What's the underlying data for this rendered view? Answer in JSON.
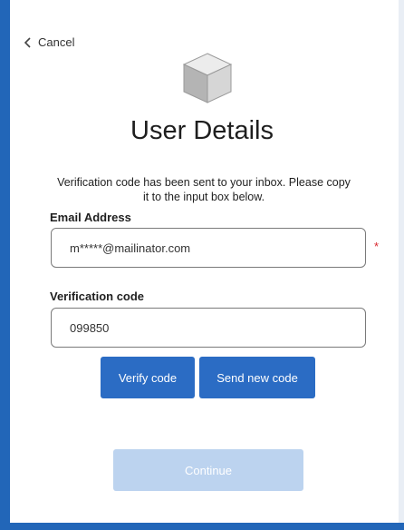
{
  "nav": {
    "cancel_label": "Cancel"
  },
  "icons": {
    "back": "chevron-left-icon",
    "logo": "cube-icon"
  },
  "header": {
    "title": "User Details"
  },
  "info": {
    "message": "Verification code has been sent to your inbox. Please copy it to the input box below."
  },
  "form": {
    "email": {
      "label": "Email Address",
      "value": "m*****@mailinator.com",
      "required_marker": "*"
    },
    "code": {
      "label": "Verification code",
      "value": "099850"
    }
  },
  "actions": {
    "verify_label": "Verify code",
    "send_new_label": "Send new code",
    "continue_label": "Continue"
  },
  "colors": {
    "accent": "#2b6cc4",
    "frame": "#2266b8",
    "disabled": "#bcd3ef",
    "required": "#d9272e"
  }
}
